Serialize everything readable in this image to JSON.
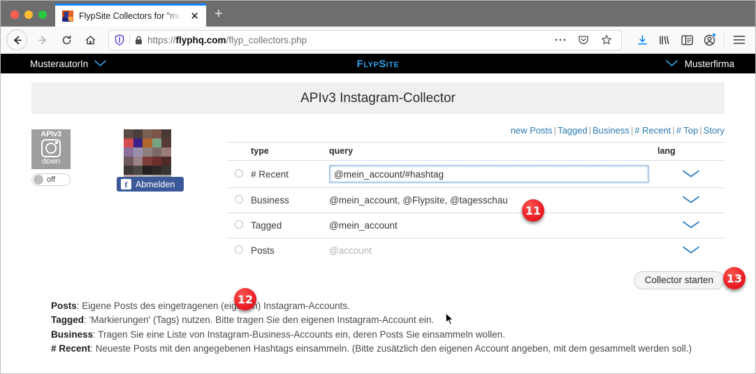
{
  "browser": {
    "tab_title": "FlypSite Collectors for \"musterf",
    "tab_close_icon": "close-icon",
    "new_tab_icon": "plus-icon",
    "url_prefix": "https://",
    "url_domain": "flyphq.com",
    "url_path": "/flyp_collectors.php",
    "shield_icon": "shield-icon",
    "lock_icon": "lock-icon",
    "page_actions_icon": "ellipsis-icon",
    "pocket_icon": "pocket-icon",
    "bookmark_icon": "star-icon",
    "downloads_icon": "download-icon",
    "library_icon": "library-icon",
    "sidebar_icon": "sidebar-icon",
    "account_icon": "account-icon",
    "menu_icon": "hamburger-menu-icon"
  },
  "site_header": {
    "user_label": "MusterautorIn",
    "user_chevron": "chevron-down-icon",
    "brand": "FlypSite",
    "org_label": "Musterfirma",
    "org_chevron": "chevron-down-icon"
  },
  "page": {
    "title": "APIv3 Instagram-Collector"
  },
  "left_panel": {
    "api_badge": "APIv3",
    "api_icon": "instagram-icon",
    "api_status": "down",
    "toggle_label": "off",
    "avatar_icon": "user-avatar-thumbnail",
    "facebook_logout": "Abmelden",
    "facebook_icon": "facebook-icon"
  },
  "nav_links": {
    "items": [
      "new Posts",
      "Tagged",
      "Business",
      "# Recent",
      "# Top",
      "Story"
    ],
    "separator": "|"
  },
  "table": {
    "headers": [
      "",
      "type",
      "query",
      "lang"
    ],
    "rows": [
      {
        "radio": "radio-unselected",
        "type": "# Recent",
        "query": "@mein_account/#hashtag",
        "query_is_placeholder": false,
        "focused": true,
        "lang_icon": "chevron-down-icon"
      },
      {
        "radio": "radio-unselected",
        "type": "Business",
        "query": "@mein_account, @Flypsite, @tagesschau",
        "query_is_placeholder": false,
        "focused": false,
        "lang_icon": "chevron-down-icon"
      },
      {
        "radio": "radio-unselected",
        "type": "Tagged",
        "query": "@mein_account",
        "query_is_placeholder": false,
        "focused": false,
        "lang_icon": "chevron-down-icon"
      },
      {
        "radio": "radio-unselected",
        "type": "Posts",
        "query": "@account",
        "query_is_placeholder": true,
        "focused": false,
        "lang_icon": "chevron-down-icon"
      }
    ]
  },
  "actions": {
    "start_button": "Collector starten"
  },
  "notes": [
    {
      "term": "Posts",
      "text": ": Eigene Posts des eingetragenen (eigenen) Instagram-Accounts."
    },
    {
      "term": "Tagged",
      "text": ": 'Markierungen' (Tags) nutzen. Bitte tragen Sie den eigenen Instagram-Account ein."
    },
    {
      "term": "Business",
      "text": ": Tragen Sie eine Liste von Instagram-Business-Accounts ein, deren Posts Sie einsammeln wollen."
    },
    {
      "term": "# Recent",
      "text": ": Neueste Posts mit den angegebenen Hashtags einsammeln. (Bitte zusätzlich den eigenen Account angeben, mit dem gesammelt werden soll.)"
    }
  ],
  "markers": [
    {
      "id": "11",
      "label": "11"
    },
    {
      "id": "12",
      "label": "12"
    },
    {
      "id": "13",
      "label": "13"
    }
  ],
  "colors": {
    "brand_blue": "#2f9fe8",
    "link_blue": "#2a7ab0",
    "marker_red": "#ec1c24",
    "facebook_blue": "#3b5998",
    "tab_accent": "#0a84ff"
  }
}
